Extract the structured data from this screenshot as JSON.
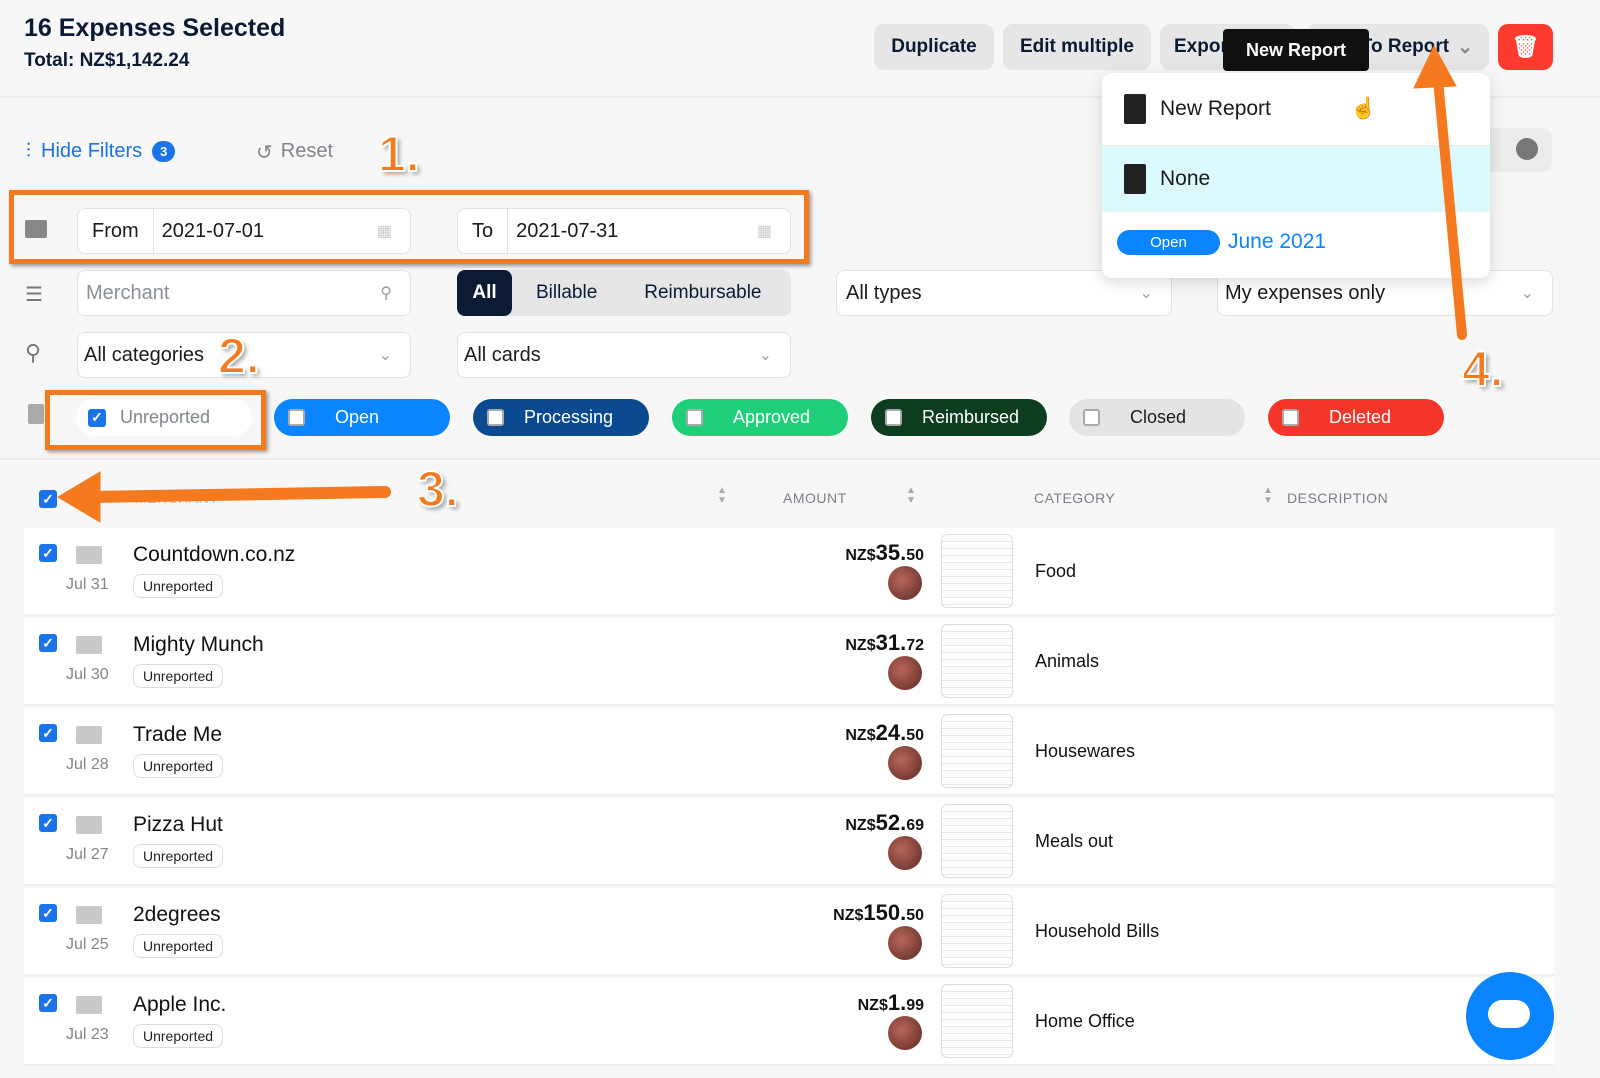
{
  "header": {
    "title": "16 Expenses Selected",
    "total": "Total: NZ$1,142.24"
  },
  "toolbar": {
    "duplicate": "Duplicate",
    "edit_multiple": "Edit multiple",
    "export": "Export to",
    "add_to_report": "Add To Report",
    "delete_icon": "trash-icon",
    "delete_color": "#ff3b30"
  },
  "tooltip": "New Report",
  "report_menu": {
    "items": [
      {
        "label": "New Report",
        "icon": "new-report-icon"
      },
      {
        "label": "None",
        "icon": "no-report-icon",
        "highlighted": true
      }
    ],
    "report": {
      "status": "Open",
      "name": "June 2021"
    }
  },
  "filters": {
    "hide_label": "Hide Filters",
    "count": "3",
    "reset": "Reset",
    "from_label": "From",
    "from_value": "2021-07-01",
    "to_label": "To",
    "to_value": "2021-07-31",
    "merchant_placeholder": "Merchant",
    "billable": [
      "All",
      "Billable",
      "Reimbursable"
    ],
    "billable_selected": "All",
    "types": "All types",
    "scope": "My expenses only",
    "categories": "All categories",
    "cards": "All cards",
    "statuses": [
      {
        "label": "Unreported",
        "checked": true,
        "color": "#ffffff"
      },
      {
        "label": "Open",
        "checked": false,
        "color": "#0a84ff"
      },
      {
        "label": "Processing",
        "checked": false,
        "color": "#0b4a91"
      },
      {
        "label": "Approved",
        "checked": false,
        "color": "#1fcf7a"
      },
      {
        "label": "Reimbursed",
        "checked": false,
        "color": "#0b3d1e"
      },
      {
        "label": "Closed",
        "checked": false,
        "color": "#e4e4e4"
      },
      {
        "label": "Deleted",
        "checked": false,
        "color": "#f4352a"
      }
    ]
  },
  "table": {
    "columns": [
      "MERCHANT",
      "AMOUNT",
      "CATEGORY",
      "DESCRIPTION"
    ],
    "rows": [
      {
        "merchant": "Countdown.co.nz",
        "date": "Jul 31",
        "status": "Unreported",
        "currency": "NZ$",
        "amount_int": "35.",
        "amount_dec": "50",
        "category": "Food"
      },
      {
        "merchant": "Mighty Munch",
        "date": "Jul 30",
        "status": "Unreported",
        "currency": "NZ$",
        "amount_int": "31.",
        "amount_dec": "72",
        "category": "Animals"
      },
      {
        "merchant": "Trade Me",
        "date": "Jul 28",
        "status": "Unreported",
        "currency": "NZ$",
        "amount_int": "24.",
        "amount_dec": "50",
        "category": "Housewares"
      },
      {
        "merchant": "Pizza Hut",
        "date": "Jul 27",
        "status": "Unreported",
        "currency": "NZ$",
        "amount_int": "52.",
        "amount_dec": "69",
        "category": "Meals out"
      },
      {
        "merchant": "2degrees",
        "date": "Jul 25",
        "status": "Unreported",
        "currency": "NZ$",
        "amount_int": "150.",
        "amount_dec": "50",
        "category": "Household Bills"
      },
      {
        "merchant": "Apple Inc.",
        "date": "Jul 23",
        "status": "Unreported",
        "currency": "NZ$",
        "amount_int": "1.",
        "amount_dec": "99",
        "category": "Home Office"
      }
    ]
  },
  "annotations": [
    "1.",
    "2.",
    "3.",
    "4."
  ],
  "accent": "#1a73e8",
  "annotation_color": "#f57a1f"
}
